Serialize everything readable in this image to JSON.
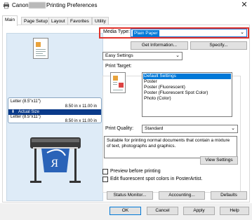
{
  "window": {
    "title_prefix": "Canon",
    "title_suffix": "Printing Preferences",
    "close_glyph": "✕"
  },
  "tabs": [
    {
      "label": "Main"
    },
    {
      "label": "Page Setup"
    },
    {
      "label": "Layout"
    },
    {
      "label": "Favorites"
    },
    {
      "label": "Utility"
    }
  ],
  "preview": {
    "size_line1": "Letter (8.5\"x11\")",
    "size_line1_dims": "8.50 in x 11.00 in",
    "actual_size_label": "Actual Size",
    "size_line2": "Letter (8.5\"x11\")",
    "size_line2_dims": "8.50 in x 11.00 in"
  },
  "media": {
    "label": "Media Type:",
    "value": "Plain Paper"
  },
  "buttons": {
    "get_information": "Get Information...",
    "specify": "Specify...",
    "view_settings": "View Settings",
    "status_monitor": "Status Monitor...",
    "accounting": "Accounting...",
    "defaults": "Defaults",
    "ok": "OK",
    "cancel": "Cancel",
    "apply": "Apply",
    "help": "Help"
  },
  "settings_mode": {
    "value": "Easy Settings"
  },
  "print_target": {
    "label": "Print Target:",
    "items": [
      {
        "label": "Default Settings",
        "selected": true
      },
      {
        "label": "Poster",
        "selected": false
      },
      {
        "label": "Poster (Fluorescent)",
        "selected": false
      },
      {
        "label": "Poster (Fluorescent Spot Color)",
        "selected": false
      },
      {
        "label": "Photo (Color)",
        "selected": false
      }
    ]
  },
  "print_quality": {
    "label": "Print Quality:",
    "value": "Standard"
  },
  "description": "Suitable for printing normal documents that contain a mixture of text, photographs and graphics.",
  "checkboxes": {
    "preview_before_printing": {
      "label": "Preview before printing",
      "checked": false
    },
    "edit_fluorescent": {
      "label": "Edit fluorescent spot colors in PosterArtist.",
      "checked": false
    }
  },
  "colors": {
    "accent": "#0078d7",
    "highlight_frame": "#e0322b",
    "preview_bg": "#deebf7",
    "size_bar": "#0a3a8a"
  }
}
